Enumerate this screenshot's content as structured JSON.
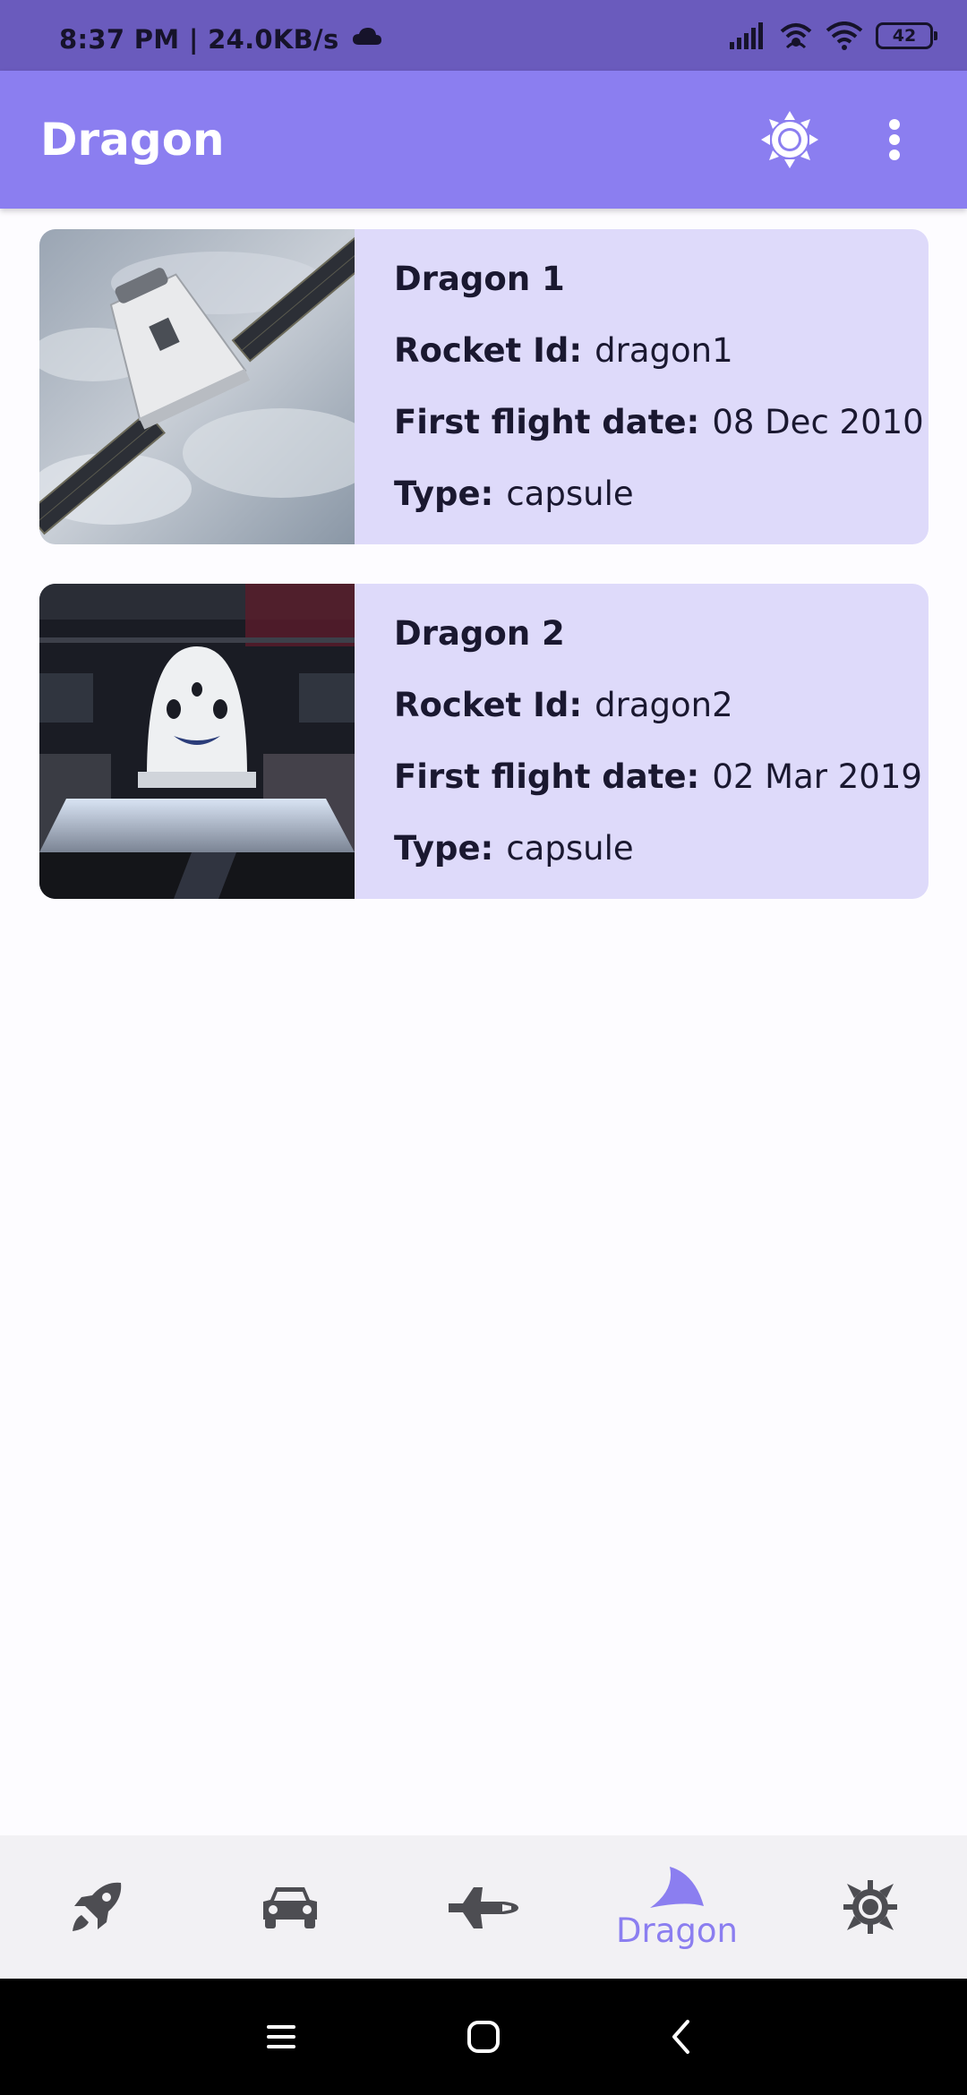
{
  "status_bar": {
    "time_text": "8:37 PM | 24.0KB/s",
    "battery": "42"
  },
  "app_bar": {
    "title": "Dragon",
    "theme_icon": "sun-icon",
    "more_icon": "more-vert-icon"
  },
  "cards": [
    {
      "name": "Dragon 1",
      "image": "dragon-1-photo",
      "fields": [
        {
          "label": "Rocket Id:",
          "value": "dragon1"
        },
        {
          "label": "First flight date:",
          "value": "08 Dec 2010"
        },
        {
          "label": "Type:",
          "value": "capsule"
        }
      ]
    },
    {
      "name": "Dragon 2",
      "image": "dragon-2-photo",
      "fields": [
        {
          "label": "Rocket Id:",
          "value": "dragon2"
        },
        {
          "label": "First flight date:",
          "value": "02 Mar 2019"
        },
        {
          "label": "Type:",
          "value": "capsule"
        }
      ]
    }
  ],
  "bottom_nav": {
    "items": [
      {
        "icon": "rocket-icon",
        "label": ""
      },
      {
        "icon": "car-icon",
        "label": ""
      },
      {
        "icon": "shuttle-icon",
        "label": ""
      },
      {
        "icon": "dragon-fin-icon",
        "label": "Dragon",
        "selected": true
      },
      {
        "icon": "ship-wheel-icon",
        "label": ""
      }
    ]
  },
  "colors": {
    "status_bar": "#6a5bbd",
    "app_bar": "#8b7ef0",
    "card_bg": "#dedafa",
    "accent": "#8b7ef0",
    "nav_inactive": "#4d4d52"
  }
}
